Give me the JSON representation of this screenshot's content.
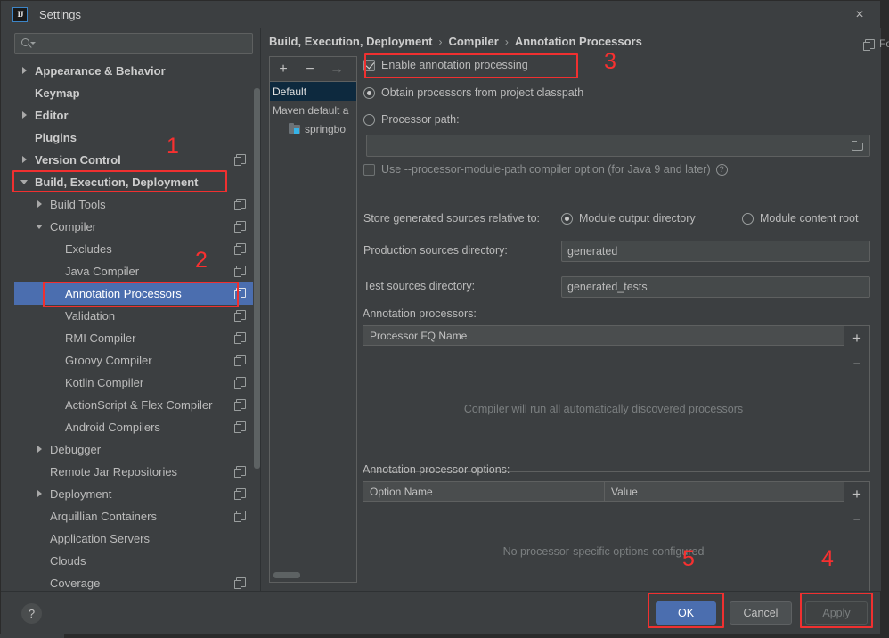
{
  "window": {
    "title": "Settings",
    "logo_text": "IJ",
    "close_icon": "×"
  },
  "sidebar": {
    "search": {
      "value": "",
      "placeholder": ""
    },
    "items": [
      {
        "label": "Appearance & Behavior",
        "arrow": "collapsed",
        "indent": 0,
        "bold": true,
        "badge": false,
        "selected": false
      },
      {
        "label": "Keymap",
        "arrow": "none",
        "indent": 0,
        "bold": true,
        "badge": false,
        "selected": false
      },
      {
        "label": "Editor",
        "arrow": "collapsed",
        "indent": 0,
        "bold": true,
        "badge": false,
        "selected": false
      },
      {
        "label": "Plugins",
        "arrow": "none",
        "indent": 0,
        "bold": true,
        "badge": false,
        "selected": false
      },
      {
        "label": "Version Control",
        "arrow": "collapsed",
        "indent": 0,
        "bold": true,
        "badge": true,
        "selected": false
      },
      {
        "label": "Build, Execution, Deployment",
        "arrow": "expanded",
        "indent": 0,
        "bold": true,
        "badge": false,
        "selected": false
      },
      {
        "label": "Build Tools",
        "arrow": "collapsed",
        "indent": 1,
        "bold": false,
        "badge": true,
        "selected": false
      },
      {
        "label": "Compiler",
        "arrow": "expanded",
        "indent": 1,
        "bold": false,
        "badge": true,
        "selected": false
      },
      {
        "label": "Excludes",
        "arrow": "none",
        "indent": 2,
        "bold": false,
        "badge": true,
        "selected": false
      },
      {
        "label": "Java Compiler",
        "arrow": "none",
        "indent": 2,
        "bold": false,
        "badge": true,
        "selected": false
      },
      {
        "label": "Annotation Processors",
        "arrow": "none",
        "indent": 2,
        "bold": false,
        "badge": true,
        "selected": true
      },
      {
        "label": "Validation",
        "arrow": "none",
        "indent": 2,
        "bold": false,
        "badge": true,
        "selected": false
      },
      {
        "label": "RMI Compiler",
        "arrow": "none",
        "indent": 2,
        "bold": false,
        "badge": true,
        "selected": false
      },
      {
        "label": "Groovy Compiler",
        "arrow": "none",
        "indent": 2,
        "bold": false,
        "badge": true,
        "selected": false
      },
      {
        "label": "Kotlin Compiler",
        "arrow": "none",
        "indent": 2,
        "bold": false,
        "badge": true,
        "selected": false
      },
      {
        "label": "ActionScript & Flex Compiler",
        "arrow": "none",
        "indent": 2,
        "bold": false,
        "badge": true,
        "selected": false
      },
      {
        "label": "Android Compilers",
        "arrow": "none",
        "indent": 2,
        "bold": false,
        "badge": true,
        "selected": false
      },
      {
        "label": "Debugger",
        "arrow": "collapsed",
        "indent": 1,
        "bold": false,
        "badge": false,
        "selected": false
      },
      {
        "label": "Remote Jar Repositories",
        "arrow": "none",
        "indent": 1,
        "bold": false,
        "badge": true,
        "selected": false
      },
      {
        "label": "Deployment",
        "arrow": "collapsed",
        "indent": 1,
        "bold": false,
        "badge": true,
        "selected": false
      },
      {
        "label": "Arquillian Containers",
        "arrow": "none",
        "indent": 1,
        "bold": false,
        "badge": true,
        "selected": false
      },
      {
        "label": "Application Servers",
        "arrow": "none",
        "indent": 1,
        "bold": false,
        "badge": false,
        "selected": false
      },
      {
        "label": "Clouds",
        "arrow": "none",
        "indent": 1,
        "bold": false,
        "badge": false,
        "selected": false
      },
      {
        "label": "Coverage",
        "arrow": "none",
        "indent": 1,
        "bold": false,
        "badge": true,
        "selected": false
      }
    ]
  },
  "main": {
    "breadcrumb": [
      "Build, Execution, Deployment",
      "Compiler",
      "Annotation Processors"
    ],
    "breadcrumb_separator": "›",
    "for_current_project": "For current project",
    "profiles": {
      "toolbar": {
        "add": "+",
        "remove": "−",
        "move": "→"
      },
      "items": [
        {
          "label": "Default",
          "selected": true,
          "icon": "none",
          "indent": 0
        },
        {
          "label": "Maven default a",
          "selected": false,
          "icon": "none",
          "indent": 0
        },
        {
          "label": "springbo",
          "selected": false,
          "icon": "module-icon",
          "indent": 1
        }
      ]
    },
    "enable_annotation_processing": {
      "label": "Enable annotation processing",
      "checked": true
    },
    "obtain_from_classpath": {
      "label": "Obtain processors from project classpath",
      "selected": true
    },
    "processor_path": {
      "label": "Processor path:",
      "selected": false,
      "value": "",
      "browse_icon": "folder-icon"
    },
    "processor_module_path": {
      "label": "Use --processor-module-path compiler option (for Java 9 and later)",
      "checked": false,
      "help_icon": "?"
    },
    "store_relative_label": "Store generated sources relative to:",
    "store_relative_options": [
      {
        "label": "Module output directory",
        "selected": true
      },
      {
        "label": "Module content root",
        "selected": false
      }
    ],
    "production_sources": {
      "label": "Production sources directory:",
      "value": "generated"
    },
    "test_sources": {
      "label": "Test sources directory:",
      "value": "generated_tests"
    },
    "processors_table": {
      "label": "Annotation processors:",
      "columns": [
        "Processor FQ Name"
      ],
      "rows": [],
      "empty_text": "Compiler will run all automatically discovered processors",
      "add": "+",
      "remove": "−"
    },
    "options_table": {
      "label": "Annotation processor options:",
      "columns": [
        "Option Name",
        "Value"
      ],
      "rows": [],
      "empty_text": "No processor-specific options configured",
      "add": "+",
      "remove": "−"
    }
  },
  "footer": {
    "help": "?",
    "ok": "OK",
    "cancel": "Cancel",
    "apply": "Apply"
  },
  "annotations": {
    "numbers": [
      "1",
      "2",
      "3",
      "4",
      "5"
    ],
    "color": "#f83030"
  }
}
